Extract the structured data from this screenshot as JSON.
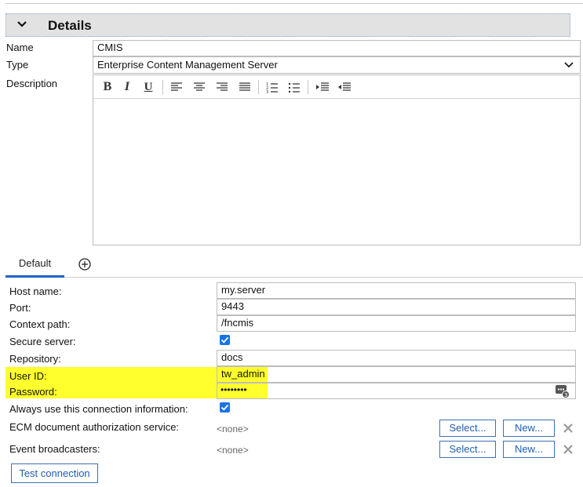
{
  "details": {
    "section_title": "Details",
    "name_label": "Name",
    "name_value": "CMIS",
    "type_label": "Type",
    "type_value": "Enterprise Content Management Server",
    "description_label": "Description",
    "toolbar": [
      "bold-icon",
      "italic-icon",
      "underline-icon",
      "align-left-icon",
      "align-center-icon",
      "align-right-icon",
      "justify-icon",
      "numbered-list-icon",
      "bullet-list-icon",
      "indent-icon",
      "outdent-icon"
    ]
  },
  "tabs": {
    "default_label": "Default"
  },
  "connection": {
    "host_label": "Host name:",
    "host_value": "my.server",
    "port_label": "Port:",
    "port_value": "9443",
    "context_label": "Context path:",
    "context_value": "/fncmis",
    "secure_label": "Secure server:",
    "secure_checked": true,
    "repo_label": "Repository:",
    "repo_value": "docs",
    "user_label": "User ID:",
    "user_value": "tw_admin",
    "password_label": "Password:",
    "password_masked": "••••••••",
    "always_label": "Always use this connection information:",
    "always_checked": true,
    "ecm_label": "ECM document authorization service:",
    "ecm_value": "<none>",
    "event_label": "Event broadcasters:",
    "event_value": "<none>",
    "select_label": "Select...",
    "new_label": "New...",
    "test_label": "Test connection"
  },
  "colors": {
    "highlight": "#ffff2d",
    "accent": "#1f62c7",
    "checkbox": "#1a73e8"
  }
}
